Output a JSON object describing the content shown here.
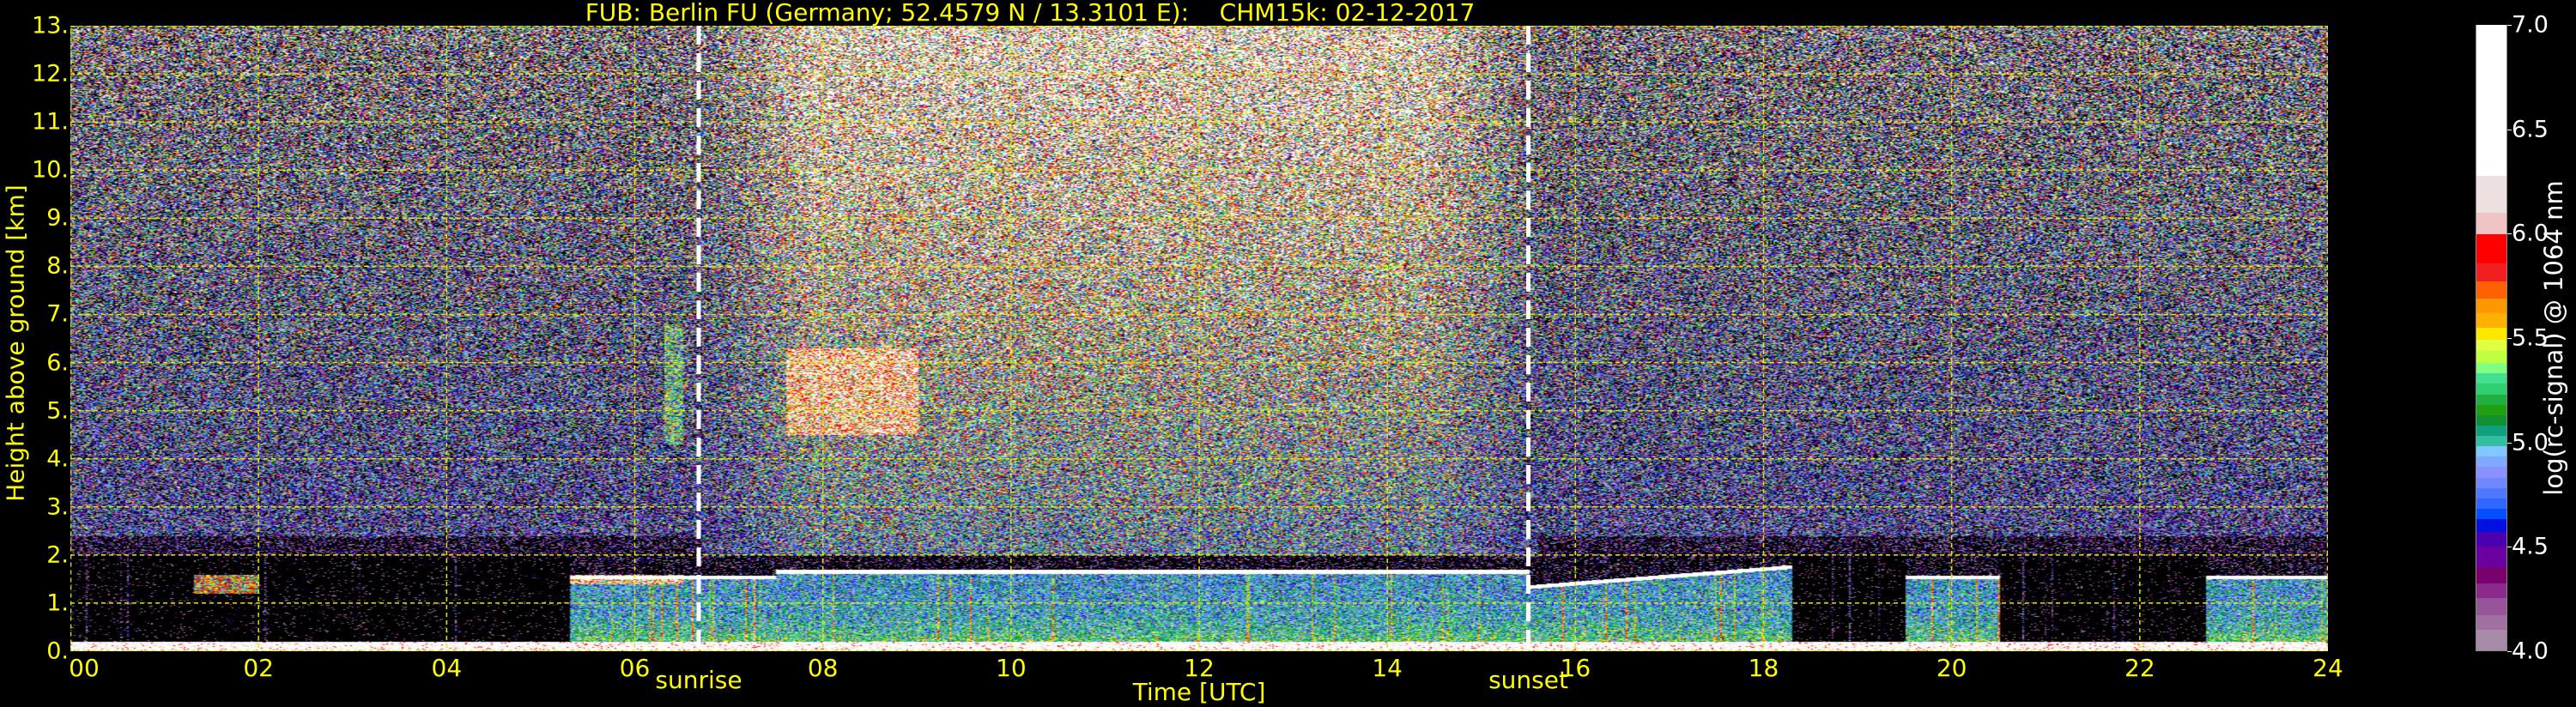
{
  "chart_data": {
    "type": "heatmap",
    "title": "FUB: Berlin FU (Germany; 52.4579 N / 13.3101 E):    CHM15k: 02-12-2017",
    "xlabel": "Time [UTC]",
    "ylabel": "Height above ground [km]",
    "xlim": [
      0,
      24
    ],
    "ylim": [
      0,
      13
    ],
    "x_ticks": [
      0,
      2,
      4,
      6,
      8,
      10,
      12,
      14,
      16,
      18,
      20,
      22,
      24
    ],
    "x_tick_labels": [
      "00",
      "02",
      "04",
      "06",
      "08",
      "10",
      "12",
      "14",
      "16",
      "18",
      "20",
      "22",
      "24"
    ],
    "y_ticks": [
      0,
      1,
      2,
      3,
      4,
      5,
      6,
      7,
      8,
      9,
      10,
      11,
      12,
      13
    ],
    "y_tick_labels": [
      "0.",
      "1.",
      "2.",
      "3.",
      "4.",
      "5.",
      "6.",
      "7.",
      "8.",
      "9.",
      "10.",
      "11.",
      "12.",
      "13."
    ],
    "grid": true,
    "annotations": [
      {
        "label": "sunrise",
        "x": 6.68
      },
      {
        "label": "sunset",
        "x": 15.5
      }
    ],
    "colorbar": {
      "label": "log(rc-signal) @ 1064 nm",
      "range": [
        4.0,
        7.0
      ],
      "ticks": [
        4.0,
        4.5,
        5.0,
        5.5,
        6.0,
        6.5,
        7.0
      ],
      "tick_labels": [
        "4.0",
        "4.5",
        "5.0",
        "5.5",
        "6.0",
        "6.5",
        "7.0"
      ],
      "levels": [
        {
          "from": 4.0,
          "color": "#a78aa7"
        },
        {
          "from": 4.1,
          "color": "#a070a0"
        },
        {
          "from": 4.17,
          "color": "#955598"
        },
        {
          "from": 4.25,
          "color": "#8a2a8a"
        },
        {
          "from": 4.32,
          "color": "#7a006e"
        },
        {
          "from": 4.4,
          "color": "#6a00a0"
        },
        {
          "from": 4.5,
          "color": "#4a00b0"
        },
        {
          "from": 4.57,
          "color": "#0010e0"
        },
        {
          "from": 4.63,
          "color": "#0050ff"
        },
        {
          "from": 4.68,
          "color": "#3068ff"
        },
        {
          "from": 4.73,
          "color": "#5078ff"
        },
        {
          "from": 4.78,
          "color": "#7088ff"
        },
        {
          "from": 4.83,
          "color": "#8a90ff"
        },
        {
          "from": 4.88,
          "color": "#80a8ff"
        },
        {
          "from": 4.93,
          "color": "#80c8ff"
        },
        {
          "from": 4.98,
          "color": "#30c0a0"
        },
        {
          "from": 5.03,
          "color": "#10a080"
        },
        {
          "from": 5.08,
          "color": "#109030"
        },
        {
          "from": 5.13,
          "color": "#20a010"
        },
        {
          "from": 5.18,
          "color": "#20b040"
        },
        {
          "from": 5.23,
          "color": "#30d070"
        },
        {
          "from": 5.28,
          "color": "#40e090"
        },
        {
          "from": 5.33,
          "color": "#80ff80"
        },
        {
          "from": 5.38,
          "color": "#c0ff40"
        },
        {
          "from": 5.44,
          "color": "#e0ff40"
        },
        {
          "from": 5.49,
          "color": "#ffe800"
        },
        {
          "from": 5.55,
          "color": "#ffb000"
        },
        {
          "from": 5.62,
          "color": "#ff9800"
        },
        {
          "from": 5.69,
          "color": "#ff6000"
        },
        {
          "from": 5.77,
          "color": "#f02020"
        },
        {
          "from": 5.86,
          "color": "#ff0000"
        },
        {
          "from": 6.0,
          "color": "#f0c4c4"
        },
        {
          "from": 6.1,
          "color": "#ece0e0"
        },
        {
          "from": 6.28,
          "color": "#ffffff"
        }
      ]
    },
    "features": [
      {
        "name": "surface layer",
        "t": [
          0,
          24
        ],
        "h": [
          0,
          0.2
        ],
        "value": 6.5
      },
      {
        "name": "boundary layer aerosol",
        "t": [
          5.3,
          18.3
        ],
        "h": [
          0.1,
          1.7
        ],
        "value": 5.0
      },
      {
        "name": "boundary layer top",
        "t": [
          7.5,
          15.5
        ],
        "h": [
          1.55,
          1.7
        ],
        "value": 6.5
      },
      {
        "name": "mid-level cloud",
        "t": [
          7.6,
          9.0
        ],
        "h": [
          4.5,
          6.3
        ],
        "value": 6.5
      },
      {
        "name": "mid-level cloud",
        "t": [
          6.3,
          6.5
        ],
        "h": [
          4.3,
          6.8
        ],
        "value": 5.6
      },
      {
        "name": "low cloud",
        "t": [
          1.3,
          2.0
        ],
        "h": [
          1.2,
          1.6
        ],
        "value": 6.0
      },
      {
        "name": "low cloud",
        "t": [
          5.3,
          6.5
        ],
        "h": [
          1.4,
          1.6
        ],
        "value": 6.5
      },
      {
        "name": "aerosol layer",
        "t": [
          22.7,
          24
        ],
        "h": [
          0.2,
          1.5
        ],
        "value": 4.8
      }
    ]
  }
}
